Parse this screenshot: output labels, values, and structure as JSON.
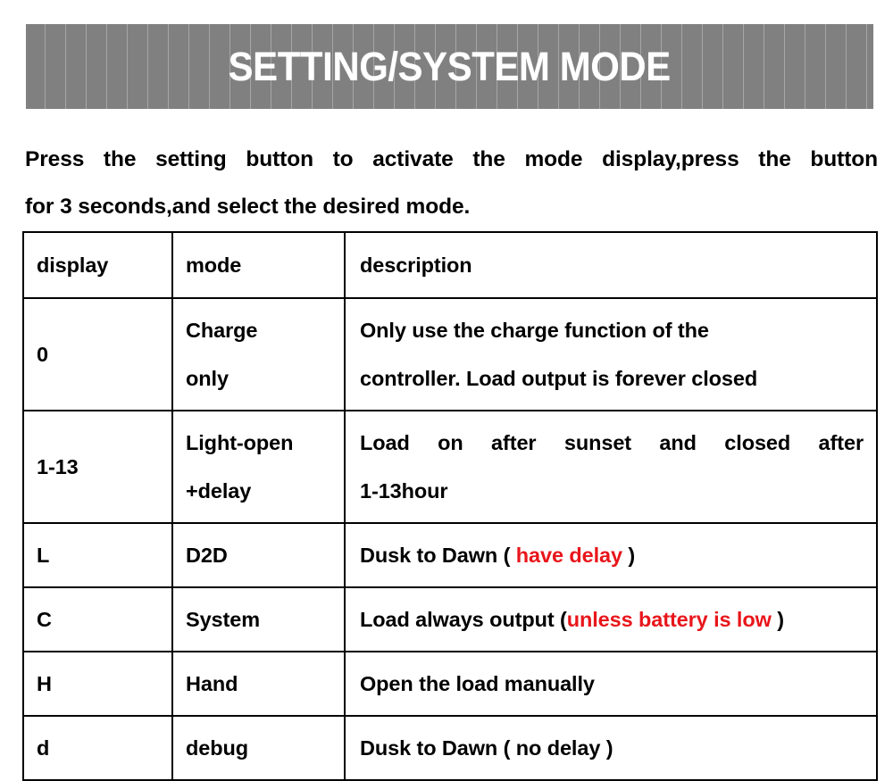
{
  "banner": {
    "title": "SETTING/SYSTEM MODE",
    "background_color": "#808080",
    "text_color": "#ffffff"
  },
  "intro": {
    "line1": "Press the setting button to activate the mode display,press the button",
    "line2": "for 3 seconds,and select the desired mode."
  },
  "table": {
    "headers": {
      "display": "display",
      "mode": "mode",
      "description": "description"
    },
    "accent_red": "#e8161b",
    "rows": [
      {
        "display": "0",
        "mode_line1": "Charge",
        "mode_line2": "only",
        "desc_line1": "Only use the charge function of the",
        "desc_line2": "controller. Load output is forever closed"
      },
      {
        "display": "1-13",
        "mode_line1": "Light-open",
        "mode_line2": "+delay",
        "desc_line1": "Load on after sunset and closed after",
        "desc_line2": "1-13hour"
      },
      {
        "display": "L",
        "mode_line1": "D2D",
        "desc_pre": "Dusk to Dawn ( ",
        "desc_red": "have delay",
        "desc_post": " )"
      },
      {
        "display": "C",
        "mode_line1": "System",
        "desc_pre": "Load always output (",
        "desc_red": "unless battery is low",
        "desc_post": " )"
      },
      {
        "display": "H",
        "mode_line1": "Hand",
        "desc_line1": "Open the load manually"
      },
      {
        "display": "d",
        "mode_line1": "debug",
        "desc_line1": "Dusk to Dawn ( no delay )"
      }
    ]
  }
}
